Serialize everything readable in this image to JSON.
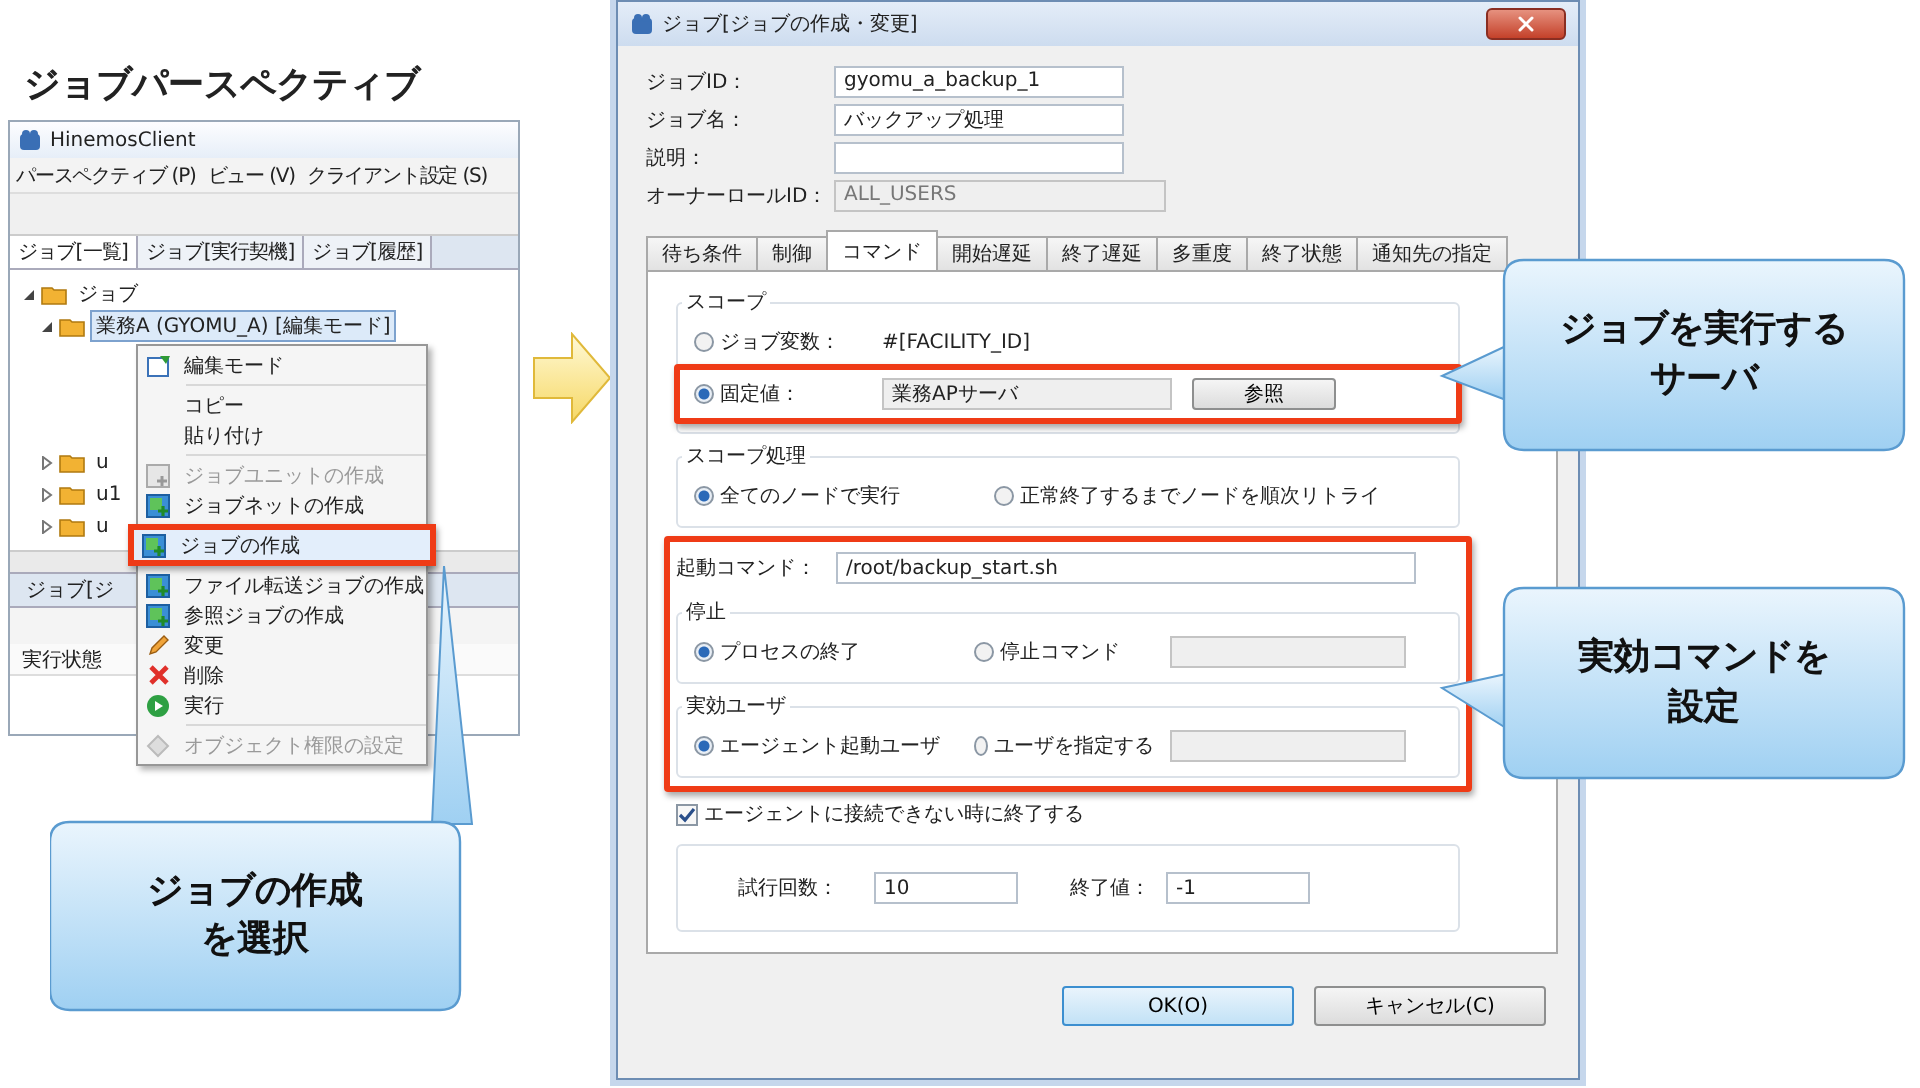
{
  "slide_title": "ジョブパースペクティブ",
  "client": {
    "title": "HinemosClient",
    "menus": [
      "パースペクティブ (P)",
      "ビュー (V)",
      "クライアント設定 (S)"
    ],
    "view_tabs": [
      {
        "label": "ジョブ[一覧]",
        "selected": true
      },
      {
        "label": "ジョブ[実行契機]",
        "selected": false
      },
      {
        "label": "ジョブ[履歴]",
        "selected": false
      }
    ],
    "tree": [
      {
        "label": "ジョブ",
        "expanded": true,
        "selected": false,
        "children": [
          {
            "label": "業務A (GYOMU_A) [編集モード]",
            "expanded": true,
            "selected": true
          },
          {
            "label": "u",
            "expanded": false,
            "selected": false
          },
          {
            "label": "u1",
            "expanded": false,
            "selected": false
          },
          {
            "label": "u",
            "expanded": false,
            "selected": false
          }
        ]
      }
    ],
    "bottom_tab": "ジョブ[ジ",
    "bottom_column": "実行状態"
  },
  "context_menu": [
    {
      "kind": "item",
      "label": "編集モード",
      "disabled": false,
      "selected": false
    },
    {
      "kind": "separator"
    },
    {
      "kind": "item",
      "label": "コピー",
      "disabled": false,
      "selected": false
    },
    {
      "kind": "item",
      "label": "貼り付け",
      "disabled": false,
      "selected": false
    },
    {
      "kind": "separator"
    },
    {
      "kind": "item",
      "label": "ジョブユニットの作成",
      "disabled": true,
      "selected": false
    },
    {
      "kind": "item",
      "label": "ジョブネットの作成",
      "disabled": false,
      "selected": false
    },
    {
      "kind": "item",
      "label": "ジョブの作成",
      "disabled": false,
      "selected": true,
      "highlighted": true
    },
    {
      "kind": "item",
      "label": "ファイル転送ジョブの作成",
      "disabled": false,
      "selected": false
    },
    {
      "kind": "item",
      "label": "参照ジョブの作成",
      "disabled": false,
      "selected": false
    },
    {
      "kind": "item",
      "label": "変更",
      "disabled": false,
      "selected": false
    },
    {
      "kind": "item",
      "label": "削除",
      "disabled": false,
      "selected": false
    },
    {
      "kind": "item",
      "label": "実行",
      "disabled": false,
      "selected": false
    },
    {
      "kind": "separator"
    },
    {
      "kind": "item",
      "label": "オブジェクト権限の設定",
      "disabled": true,
      "selected": false
    }
  ],
  "callouts": [
    {
      "lines": [
        "ジョブの作成",
        "を選択"
      ]
    },
    {
      "lines": [
        "ジョブを実行する",
        "サーバ"
      ]
    },
    {
      "lines": [
        "実効コマンドを",
        "設定"
      ]
    }
  ],
  "dialog": {
    "title": "ジョブ[ジョブの作成・変更]",
    "fields": [
      {
        "label": "ジョブID：",
        "value": "gyomu_a_backup_1",
        "disabled": false
      },
      {
        "label": "ジョブ名：",
        "value": "バックアップ処理",
        "disabled": false
      },
      {
        "label": "説明：",
        "disabled": false
      },
      {
        "label": "オーナーロールID：",
        "value": "ALL_USERS",
        "disabled": true
      }
    ],
    "tabs": [
      {
        "label": "待ち条件",
        "selected": false
      },
      {
        "label": "制御",
        "selected": false
      },
      {
        "label": "コマンド",
        "selected": true
      },
      {
        "label": "開始遅延",
        "selected": false
      },
      {
        "label": "終了遅延",
        "selected": false
      },
      {
        "label": "多重度",
        "selected": false
      },
      {
        "label": "終了状態",
        "selected": false
      },
      {
        "label": "通知先の指定",
        "selected": false
      }
    ],
    "scope": {
      "title": "スコープ",
      "variable": {
        "label": "ジョブ変数：",
        "value": "#[FACILITY_ID]",
        "selected": false
      },
      "fixed": {
        "label": "固定値：",
        "value": "業務APサーバ",
        "selected": true,
        "button": "参照",
        "highlighted": true
      }
    },
    "scope_processing": {
      "title": "スコープ処理",
      "options": [
        {
          "label": "全てのノードで実行",
          "selected": true
        },
        {
          "label": "正常終了するまでノードを順次リトライ",
          "selected": false
        }
      ]
    },
    "command": {
      "highlighted": true,
      "label": "起動コマンド：",
      "value": "/root/backup_start.sh",
      "stop": {
        "title": "停止",
        "options": [
          {
            "label": "プロセスの終了",
            "selected": true
          },
          {
            "label": "停止コマンド",
            "selected": false
          }
        ],
        "field": {
          "disabled": true
        }
      },
      "user": {
        "title": "実効ユーザ",
        "options": [
          {
            "label": "エージェント起動ユーザ",
            "selected": true
          },
          {
            "label": "ユーザを指定する",
            "selected": false
          }
        ],
        "field": {
          "disabled": true
        }
      }
    },
    "end_on_disconnect": {
      "label": "エージェントに接続できない時に終了する",
      "checked": true
    },
    "retry": [
      {
        "label": "試行回数：",
        "value": "10"
      },
      {
        "label": "終了値：",
        "value": "-1"
      }
    ],
    "buttons": [
      {
        "label": "OK(O)",
        "default": true
      },
      {
        "label": "キャンセル(C)",
        "default": false
      }
    ]
  }
}
